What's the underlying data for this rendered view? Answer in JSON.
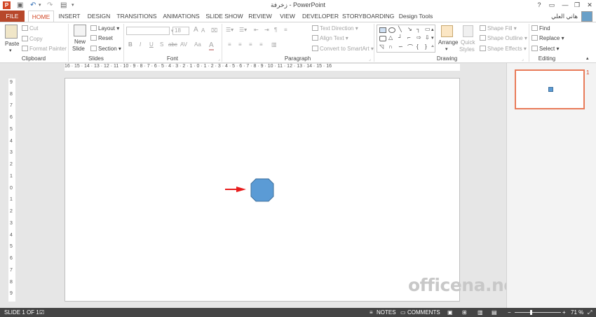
{
  "app": {
    "icon": "P",
    "title": "زخرفة - PowerPoint"
  },
  "qat": {
    "save_icon": "save-icon",
    "undo_icon": "undo-icon",
    "redo_icon": "redo-icon",
    "present_icon": "slideshow-icon"
  },
  "window": {
    "help": "?",
    "minimize": "—",
    "restore": "❐",
    "close": "✕"
  },
  "tabs": [
    "FILE",
    "HOME",
    "INSERT",
    "DESIGN",
    "TRANSITIONS",
    "ANIMATIONS",
    "SLIDE SHOW",
    "REVIEW",
    "VIEW",
    "DEVELOPER",
    "STORYBOARDING",
    "Design Tools"
  ],
  "user": {
    "name": "هاني العلي"
  },
  "ribbon": {
    "clipboard": {
      "label": "Clipboard",
      "paste": "Paste",
      "cut": "Cut",
      "copy": "Copy",
      "format_painter": "Format Painter"
    },
    "slides": {
      "label": "Slides",
      "new_slide": "New",
      "new_slide2": "Slide",
      "layout": "Layout",
      "reset": "Reset",
      "section": "Section"
    },
    "font": {
      "label": "Font",
      "font_name": "",
      "font_size": "18",
      "bold": "B",
      "italic": "I",
      "underline": "U",
      "strike": "S",
      "shadow": "abc",
      "spacing": "AV",
      "case": "Aa",
      "color": "A"
    },
    "paragraph": {
      "label": "Paragraph",
      "text_direction": "Text Direction",
      "align_text": "Align Text",
      "convert_smartart": "Convert to SmartArt"
    },
    "drawing": {
      "label": "Drawing",
      "arrange": "Arrange",
      "quick_styles": "Quick",
      "quick_styles2": "Styles",
      "shape_fill": "Shape Fill",
      "shape_outline": "Shape Outline",
      "shape_effects": "Shape Effects"
    },
    "editing": {
      "label": "Editing",
      "find": "Find",
      "replace": "Replace",
      "select": "Select"
    }
  },
  "ruler": {
    "horizontal": "16 · 15 · 14 · 13 · 12 · 11 · 10 · 9 · 8 · 7 · 6 · 5 · 4 · 3 · 2 · 1 · 0 · 1 · 2 · 3 · 4 · 5 · 6 · 7 · 8 · 9 · 10 · 11 · 12 · 13 · 14 · 15 · 16",
    "vertical": [
      "9",
      "8",
      "7",
      "6",
      "5",
      "4",
      "3",
      "2",
      "1",
      "0",
      "1",
      "2",
      "3",
      "4",
      "5",
      "6",
      "7",
      "8",
      "9"
    ]
  },
  "slide": {
    "shape": "octagon",
    "shape_color": "#5b9bd5",
    "arrow_color": "#e81c1c"
  },
  "watermark": "officena.net",
  "thumbnail": {
    "number": "1"
  },
  "status": {
    "slide_info": "SLIDE 1 OF 1",
    "notes": "NOTES",
    "comments": "COMMENTS",
    "zoom": "71 %",
    "minus": "−",
    "plus": "+"
  },
  "colors": {
    "accent": "#d24726",
    "file_tab": "#b7472a",
    "statusbar": "#444444"
  }
}
